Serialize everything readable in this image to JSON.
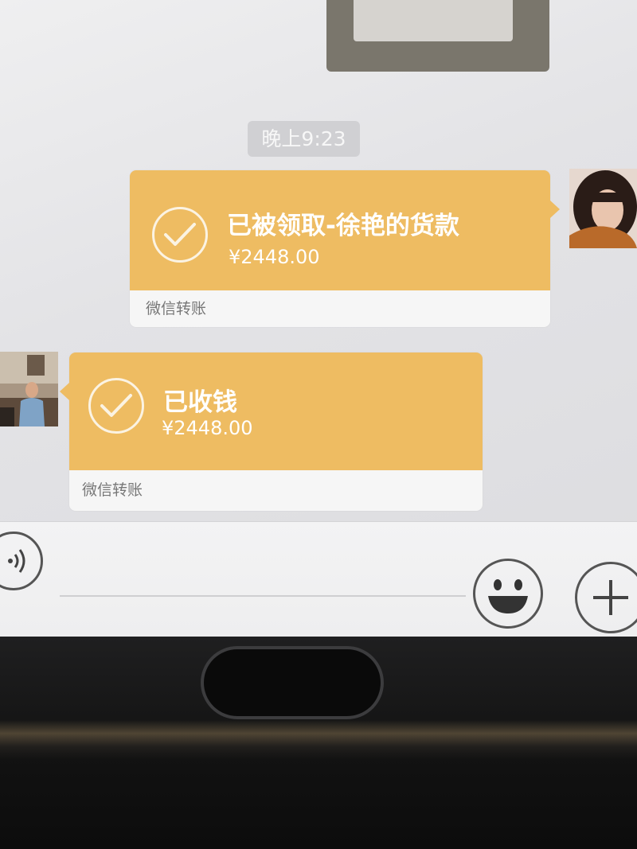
{
  "chat": {
    "timestamp": "晚上9:23",
    "messages": [
      {
        "side": "right",
        "kind": "transfer",
        "title": "已被领取-徐艳的货款",
        "amount": "¥2448.00",
        "footer": "微信转账"
      },
      {
        "side": "left",
        "kind": "transfer",
        "title": "已收钱",
        "amount": "¥2448.00",
        "footer": "微信转账"
      }
    ]
  },
  "input_bar": {
    "voice_icon": "voice-icon",
    "emoji_icon": "emoji-icon",
    "plus_icon": "plus-icon"
  },
  "colors": {
    "transfer_bubble": "#eebc62",
    "footer_bg": "#f6f6f6",
    "timestamp_bg": "#d0d0d3"
  }
}
